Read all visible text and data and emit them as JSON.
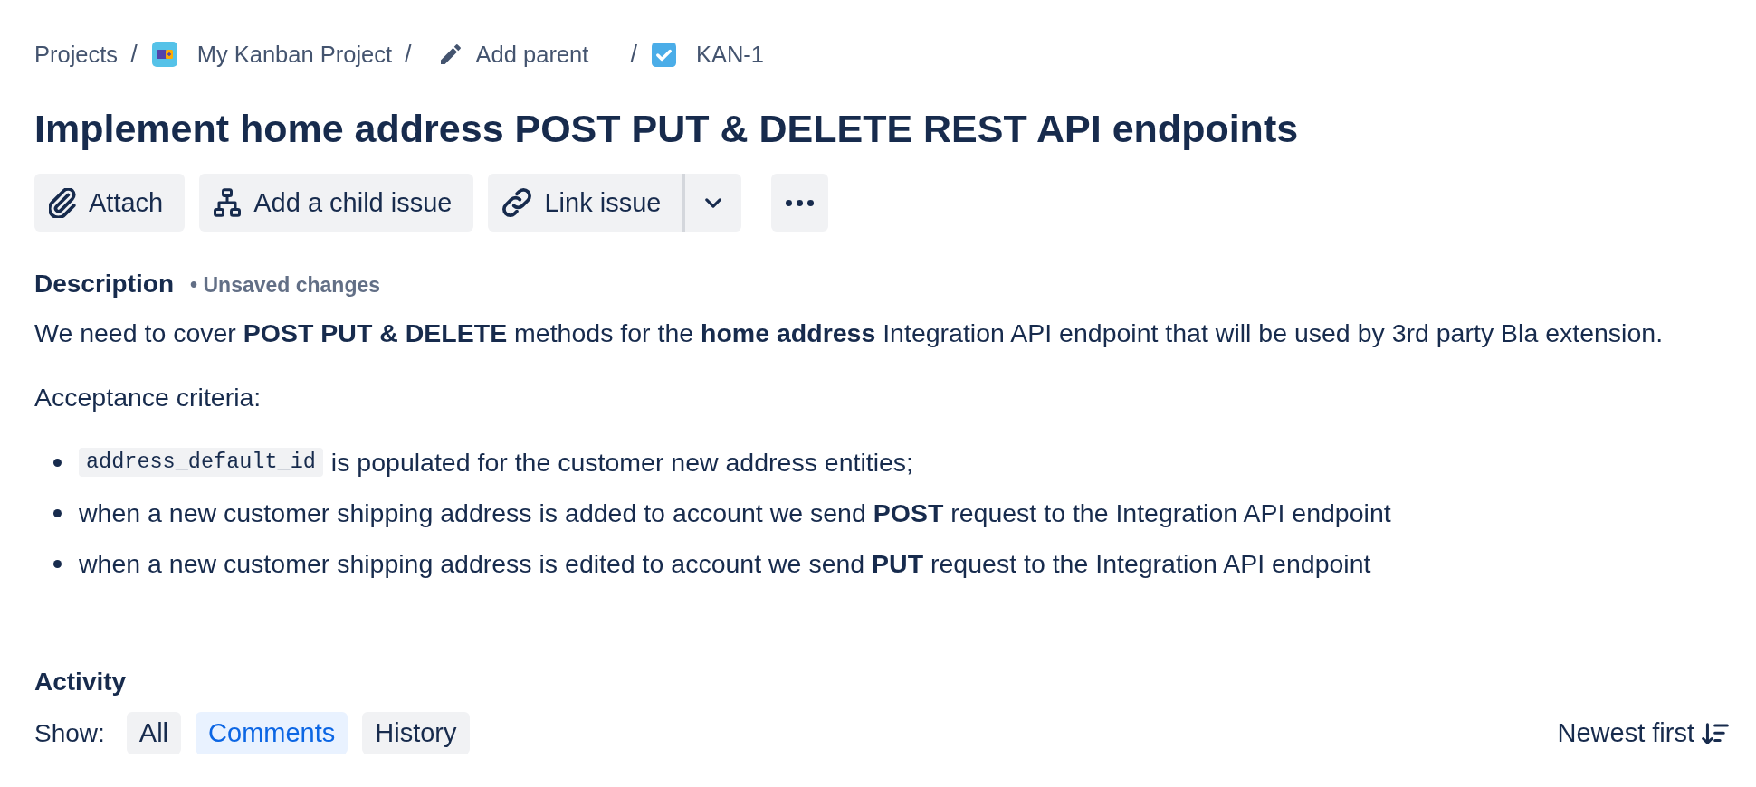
{
  "breadcrumbs": [
    {
      "kind": "link",
      "label": "Projects",
      "separator": "/"
    },
    {
      "kind": "project",
      "label": "My Kanban Project",
      "separator": "/"
    },
    {
      "kind": "parent",
      "label": "Add parent",
      "separator": "/"
    },
    {
      "kind": "issue",
      "label": "KAN-1"
    }
  ],
  "title": "Implement home address POST PUT & DELETE REST API endpoints",
  "actions": [
    {
      "kind": "attach",
      "label": "Attach"
    },
    {
      "kind": "child",
      "label": "Add a child issue"
    },
    {
      "kind": "link_split",
      "label": "Link issue"
    },
    {
      "kind": "more"
    }
  ],
  "description": {
    "heading": "Description",
    "status": "• Unsaved changes",
    "paragraphs": [
      "We need to cover **POST PUT & DELETE** methods for the **home address** Integration API endpoint that will be used by 3rd party Bla extension.",
      "Acceptance criteria:"
    ],
    "bullets": [
      {
        "parts": [
          {
            "kind": "code",
            "text": "address_default_id"
          },
          {
            "kind": "text",
            "text": "is populated for the customer new address entities;"
          }
        ]
      },
      {
        "parts": [
          {
            "kind": "text",
            "text": "when a new customer shipping address is added to account we send **POST** request to the Integration API endpoint"
          }
        ]
      },
      {
        "parts": [
          {
            "kind": "text",
            "text": "when a new customer shipping address is edited to account we send **PUT** request to the Integration API endpoint"
          }
        ]
      }
    ]
  },
  "activity": {
    "heading": "Activity",
    "filter_label": "Show:",
    "filters": [
      {
        "label": "All",
        "selected": false
      },
      {
        "label": "Comments",
        "selected": true
      },
      {
        "label": "History",
        "selected": false
      }
    ],
    "sort": {
      "label": "Newest first"
    }
  }
}
